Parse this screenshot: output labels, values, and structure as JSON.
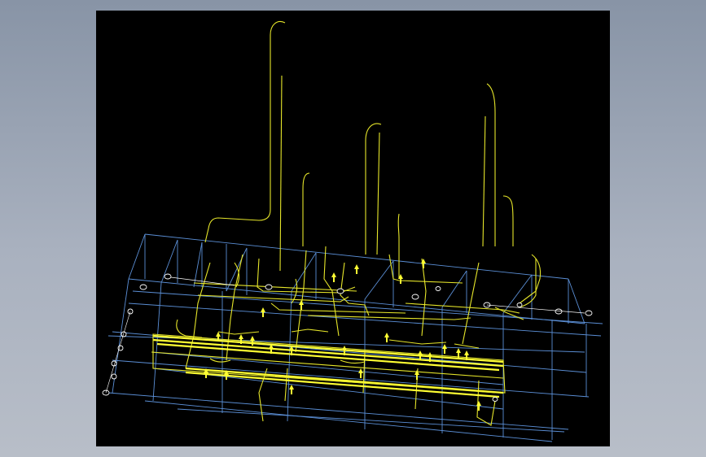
{
  "viewport": {
    "background": "#000000",
    "grid_color": "#5b8fd6",
    "pipe_color": "#ffff33",
    "node_color": "#ffffff"
  }
}
